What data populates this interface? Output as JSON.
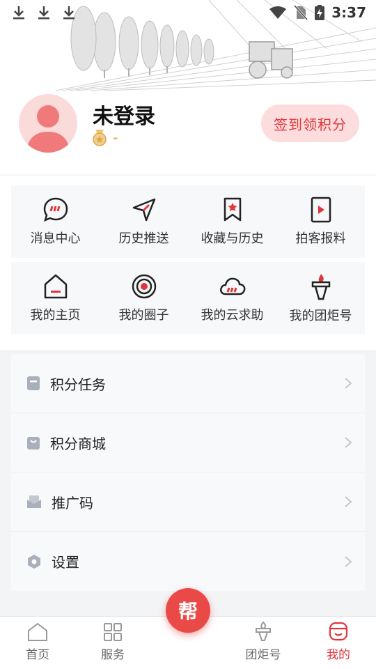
{
  "status_bar": {
    "time": "3:37",
    "download_icons": [
      "download-icon",
      "download-icon",
      "download-icon"
    ],
    "right_icons": [
      "wifi-icon",
      "no-sim-icon",
      "battery-charging-icon"
    ]
  },
  "profile": {
    "name": "未登录",
    "level": "-",
    "checkin_label": "签到领积分"
  },
  "grid": [
    {
      "label": "消息中心",
      "icon": "message-icon"
    },
    {
      "label": "历史推送",
      "icon": "send-icon"
    },
    {
      "label": "收藏与历史",
      "icon": "bookmark-icon"
    },
    {
      "label": "拍客报料",
      "icon": "video-icon"
    },
    {
      "label": "我的主页",
      "icon": "home-icon"
    },
    {
      "label": "我的圈子",
      "icon": "target-icon"
    },
    {
      "label": "我的云求助",
      "icon": "cloud-icon"
    },
    {
      "label": "我的团炬号",
      "icon": "torch-icon"
    }
  ],
  "menu": [
    {
      "label": "积分任务",
      "icon": "task-icon"
    },
    {
      "label": "积分商城",
      "icon": "shop-icon"
    },
    {
      "label": "推广码",
      "icon": "mail-icon"
    },
    {
      "label": "设置",
      "icon": "settings-icon"
    }
  ],
  "bottom_nav": {
    "tabs": [
      {
        "label": "首页",
        "icon": "home-icon"
      },
      {
        "label": "服务",
        "icon": "grid-icon"
      },
      {
        "label": "团炬号",
        "icon": "torch-icon"
      },
      {
        "label": "我的",
        "icon": "profile-icon"
      }
    ],
    "center_label": "帮",
    "active_tab": "我的"
  },
  "colors": {
    "accent": "#e0363b",
    "checkin_bg": "#fcdcdc",
    "avatar_bg": "#fbdada",
    "center_button": "#ea4a47"
  }
}
